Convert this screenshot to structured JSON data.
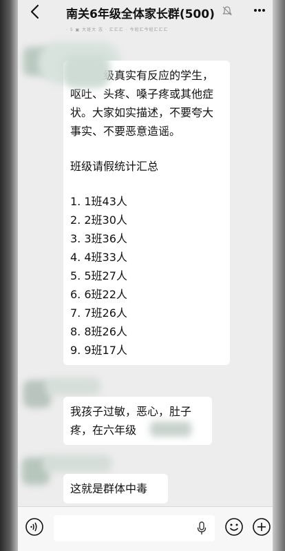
{
  "header": {
    "title": "南关6年级全体家长群(500)",
    "subtitle_strip": "· 5 ▣ 大班大 志 · 汇汇汇 · 今班汇今班汇汇汇"
  },
  "messages": [
    {
      "paragraph1": "收集班级真实有反应的学生，呕吐、头疼、嗓子疼或其他症状。大家如实描述，不要夸大事实、不要恶意造谣。",
      "heading": "班级请假统计汇总",
      "list": [
        "1. 1班43人",
        "2. 2班30人",
        "3. 3班36人",
        "4. 4班33人",
        "5. 5班27人",
        "6. 6班22人",
        "7. 7班26人",
        "8. 8班26人",
        "9. 9班17人"
      ]
    },
    {
      "text": "我孩子过敏，恶心，肚子疼，在六年级"
    },
    {
      "text": "这就是群体中毒"
    }
  ],
  "icons": {
    "back": "chevron-left-icon",
    "mute": "bell-off-icon",
    "more": "more-icon",
    "voice": "voice-icon",
    "mic": "mic-icon",
    "emoji": "emoji-icon",
    "plus": "plus-icon"
  },
  "colors": {
    "background": "#ededed",
    "bubble": "#ffffff",
    "text": "#111111"
  }
}
